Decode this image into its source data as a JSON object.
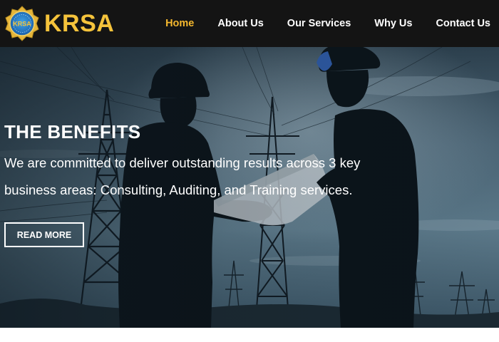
{
  "brand": {
    "logo_text": "KRSA",
    "name": "KRSA"
  },
  "nav": {
    "items": [
      {
        "label": "Home",
        "active": true
      },
      {
        "label": "About Us",
        "active": false
      },
      {
        "label": "Our Services",
        "active": false
      },
      {
        "label": "Why Us",
        "active": false
      },
      {
        "label": "Contact Us",
        "active": false
      }
    ]
  },
  "hero": {
    "title": "THE BENEFITS",
    "text": "We are committed to deliver outstanding results across 3 key business areas: Consulting, Auditing, and Training services.",
    "button_label": "READ MORE"
  },
  "colors": {
    "navbar_bg": "#141414",
    "accent": "#f5b82e",
    "brand_text": "#f5c33b",
    "text": "#ffffff"
  }
}
